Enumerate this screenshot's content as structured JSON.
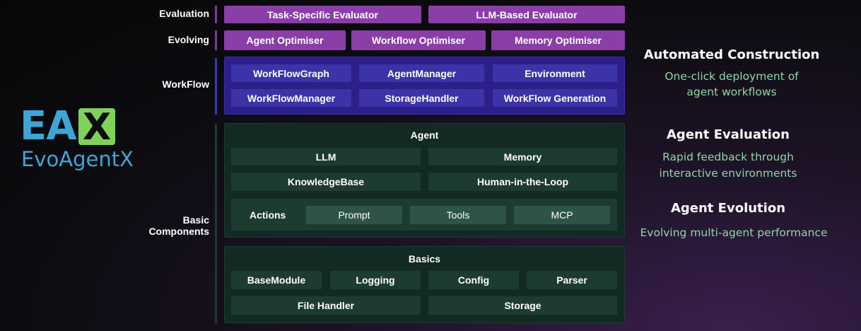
{
  "logo": {
    "letters": "EAX",
    "name": "EvoAgentX",
    "color_light": "#3ea6d6",
    "color_green": "#7fd15b"
  },
  "layers": {
    "evaluation": {
      "label": "Evaluation",
      "items": [
        "Task-Specific Evaluator",
        "LLM-Based Evaluator"
      ]
    },
    "evolving": {
      "label": "Evolving",
      "items": [
        "Agent Optimiser",
        "Workflow Optimiser",
        "Memory Optimiser"
      ]
    },
    "workflow": {
      "label": "WorkFlow",
      "items": [
        "WorkFlowGraph",
        "AgentManager",
        "Environment",
        "WorkFlowManager",
        "StorageHandler",
        "WorkFlow Generation"
      ]
    },
    "basic": {
      "label_line1": "Basic",
      "label_line2": "Components",
      "agent": {
        "title": "Agent",
        "items": [
          "LLM",
          "Memory",
          "KnowledgeBase",
          "Human-in-the-Loop"
        ],
        "actions_label": "Actions",
        "actions": [
          "Prompt",
          "Tools",
          "MCP"
        ]
      },
      "basics": {
        "title": "Basics",
        "items": [
          "BaseModule",
          "Logging",
          "Config",
          "Parser",
          "File Handler",
          "Storage"
        ]
      }
    }
  },
  "features": [
    {
      "title": "Automated Construction",
      "line1": "One-click deployment of",
      "line2": "agent workflows"
    },
    {
      "title": "Agent Evaluation",
      "line1": "Rapid feedback through",
      "line2": "interactive environments"
    },
    {
      "title": "Agent Evolution",
      "line1": "Evolving multi-agent performance",
      "line2": ""
    }
  ],
  "colors": {
    "purple": "#8a3ea8",
    "blue": "#3c33a8",
    "green": "#1e3b31",
    "accent_text": "#8fd6a6"
  }
}
